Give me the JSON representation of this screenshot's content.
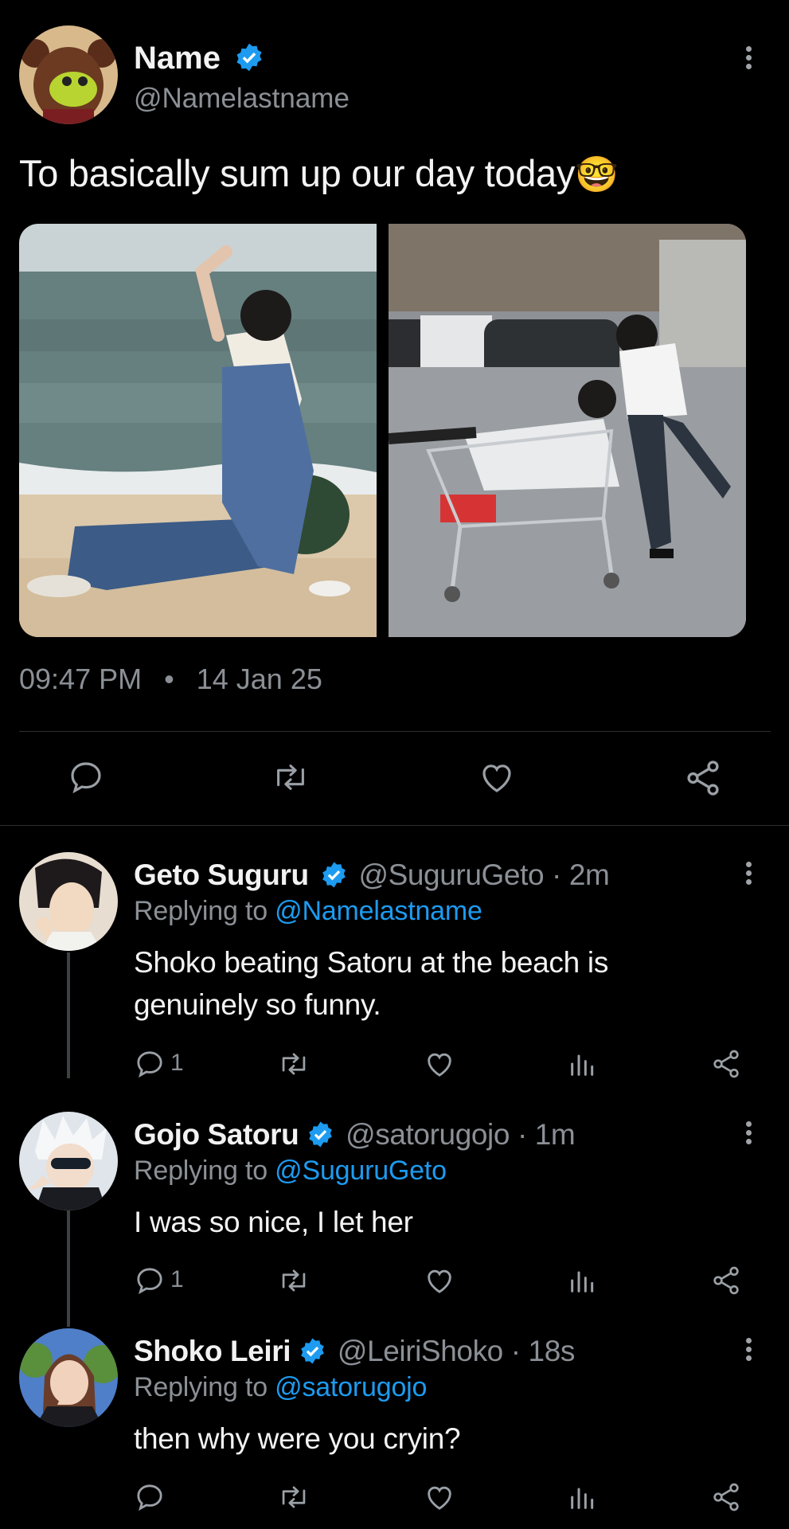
{
  "post": {
    "author_name": "Name",
    "author_handle": "@Namelastname",
    "text": "To basically sum up our day today",
    "emoji": "🤓",
    "time": "09:47 PM",
    "separator": "•",
    "date": "14 Jan 25"
  },
  "replies": [
    {
      "name": "Geto Suguru",
      "handle": "@SuguruGeto",
      "time": "· 2m",
      "replying_prefix": "Replying to ",
      "replying_to": "@Namelastname",
      "text_line1": "Shoko beating Satoru at the beach is",
      "text_line2": "genuinely so funny.",
      "reply_count": "1"
    },
    {
      "name": "Gojo Satoru",
      "handle": "@satorugojo",
      "time": "· 1m",
      "replying_prefix": "Replying to ",
      "replying_to": "@SuguruGeto",
      "text_line1": "I was so nice, I let her",
      "reply_count": "1"
    },
    {
      "name": "Shoko Leiri",
      "handle": "@LeiriShoko",
      "time": "· 18s",
      "replying_prefix": "Replying to ",
      "replying_to": "@satorugojo",
      "text_line1": "then why were you cryin?",
      "reply_count": ""
    }
  ],
  "colors": {
    "background": "#000000",
    "link": "#1d9bf0",
    "verified": "#1d9bf0",
    "muted": "#8b9096"
  },
  "icons": [
    "verified-badge-icon",
    "more-vertical-icon",
    "reply-icon",
    "retweet-icon",
    "like-icon",
    "share-icon",
    "views-icon"
  ]
}
